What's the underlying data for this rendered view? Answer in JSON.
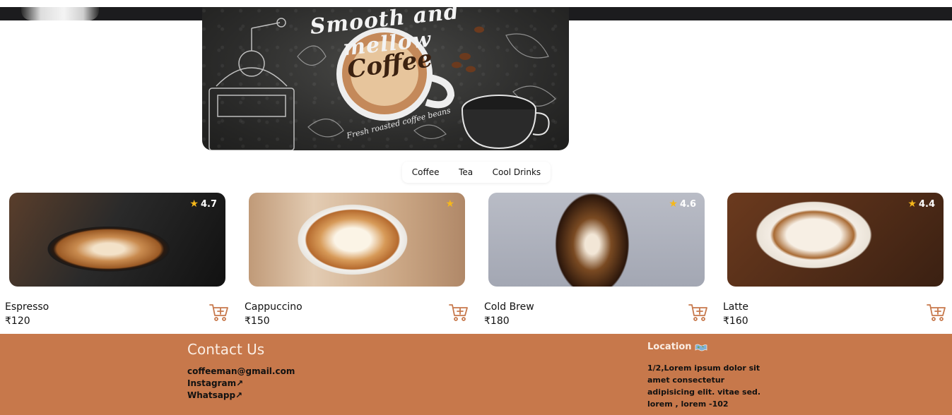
{
  "hero": {
    "script_text": "Smooth and mellow",
    "coffee_word": "Coffee",
    "subtitle": "Fresh roasted coffee beans"
  },
  "tabs": [
    {
      "label": "Coffee"
    },
    {
      "label": "Tea"
    },
    {
      "label": "Cool Drinks"
    }
  ],
  "products": [
    {
      "name": "Espresso",
      "price": "₹120",
      "rating": "4.7"
    },
    {
      "name": "Cappuccino",
      "price": "₹150",
      "rating": ""
    },
    {
      "name": "Cold Brew",
      "price": "₹180",
      "rating": "4.6"
    },
    {
      "name": "Latte",
      "price": "₹160",
      "rating": "4.4"
    }
  ],
  "footer": {
    "contact_title": "Contact Us",
    "email": "coffeeman@gmail.com",
    "instagram": "Instagram↗",
    "whatsapp": "Whatsapp↗",
    "location_title": "Location",
    "location_text": "1/2,Lorem ipsum dolor sit amet consectetur adipisicing elit. vitae sed. lorem , lorem -102"
  },
  "icons": {
    "cart": "cart-add-icon",
    "star": "star-icon",
    "location": "map-icon"
  },
  "colors": {
    "footer_bg": "#c7784b",
    "accent": "#c7784b",
    "star": "#f6b81a"
  }
}
